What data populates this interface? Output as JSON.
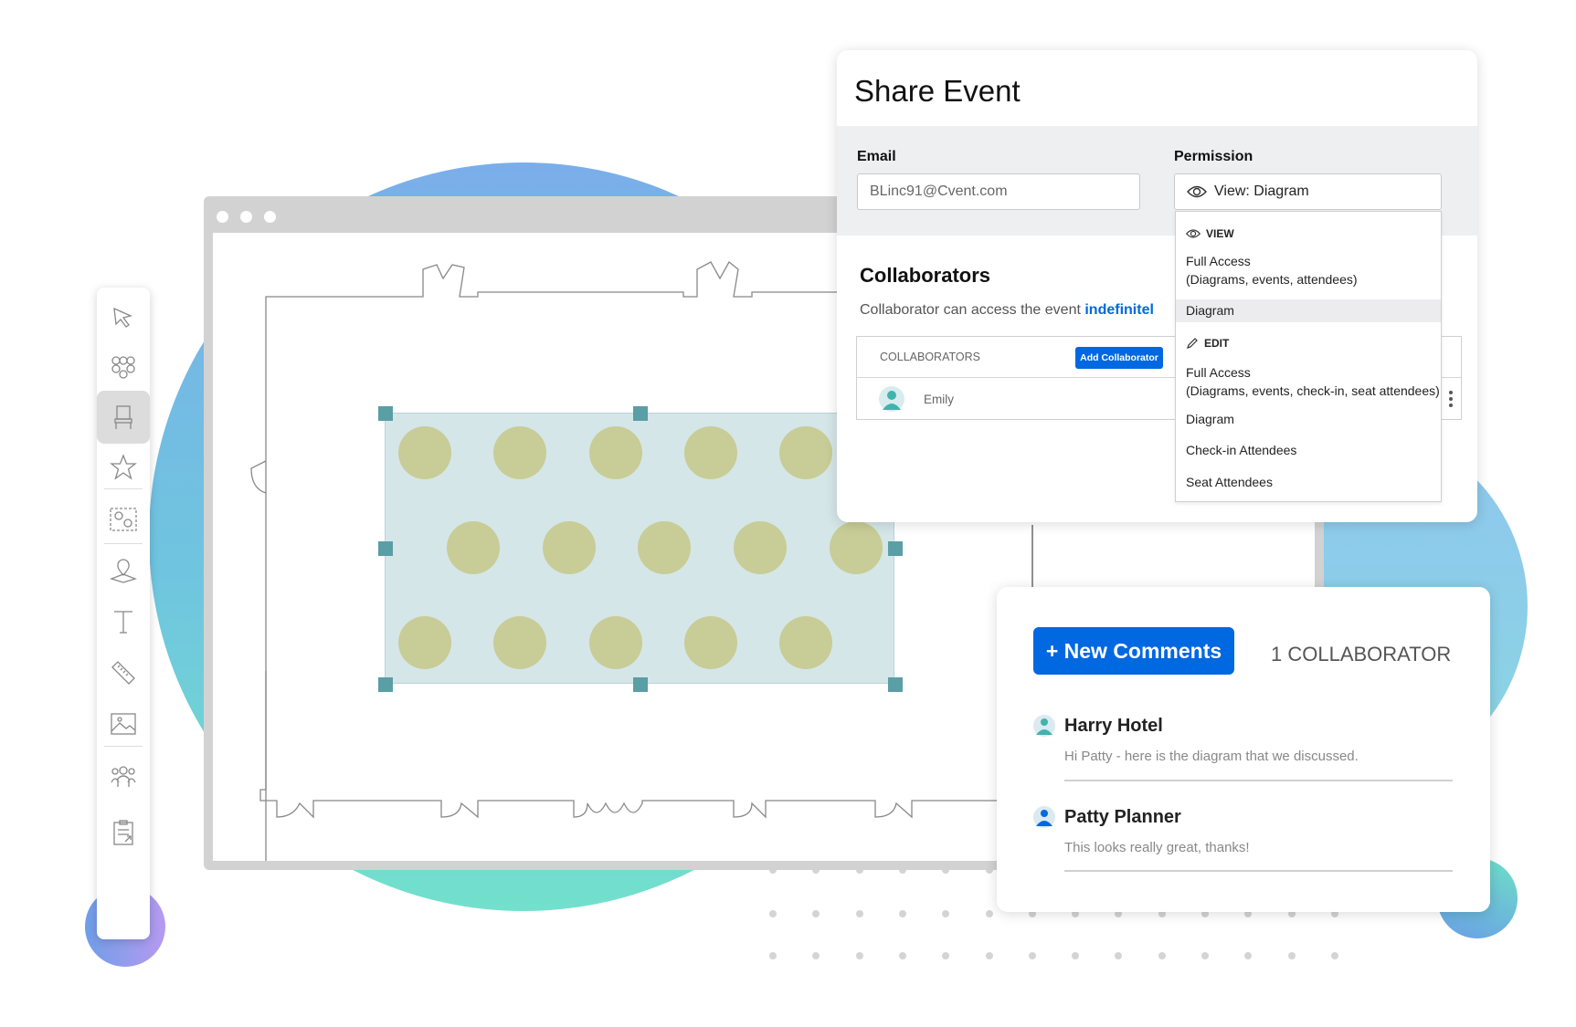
{
  "colors": {
    "accent": "#0068e0",
    "table_fill": "#d5e6e8",
    "seat": "#c8cc96",
    "handle": "#5a9ea6"
  },
  "toolbar": {
    "tools": [
      {
        "name": "select-arrow",
        "active": false
      },
      {
        "name": "round-table",
        "active": false
      },
      {
        "name": "chair",
        "active": true
      },
      {
        "name": "star",
        "active": false
      },
      {
        "name": "group-settings",
        "active": false
      },
      {
        "name": "location-pin",
        "active": false
      },
      {
        "name": "text",
        "active": false
      },
      {
        "name": "ruler",
        "active": false
      },
      {
        "name": "image",
        "active": false
      },
      {
        "name": "attendees",
        "active": false
      },
      {
        "name": "clipboard-export",
        "active": false
      }
    ]
  },
  "share": {
    "title": "Share Event",
    "email_label": "Email",
    "email_value": "BLinc91@Cvent.com",
    "permission_label": "Permission",
    "permission_value": "View: Diagram",
    "dropdown": {
      "view_header": "VIEW",
      "view_full": "Full Access",
      "view_full_sub": "(Diagrams, events, attendees)",
      "view_diagram": "Diagram",
      "edit_header": "EDIT",
      "edit_full": "Full Access",
      "edit_full_sub": "(Diagrams, events, check-in, seat attendees)",
      "edit_diagram": "Diagram",
      "edit_checkin": "Check-in Attendees",
      "edit_seat": "Seat Attendees",
      "selected": "view_diagram"
    },
    "collab_heading": "Collaborators",
    "collab_text": "Collaborator can access the event ",
    "collab_link": "indefinitel",
    "table_header": "COLLABORATORS",
    "add_button": "Add Collaborator",
    "rows": [
      {
        "name": "Emily"
      }
    ]
  },
  "comments": {
    "new_button": "+ New Comments",
    "count_label": "1 COLLABORATOR",
    "items": [
      {
        "author": "Harry Hotel",
        "message": "Hi Patty - here is the diagram that  we discussed.",
        "avatar_color": "#3fb4ae"
      },
      {
        "author": "Patty Planner",
        "message": "This looks really great, thanks!",
        "avatar_color": "#0068e0"
      }
    ]
  }
}
